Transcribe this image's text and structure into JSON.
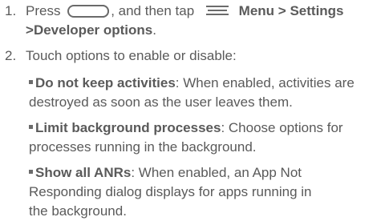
{
  "steps": [
    {
      "number": "1.",
      "press": "Press",
      "then_tap": ", and then tap",
      "menu": "Menu",
      "sep1": ">",
      "settings": "Settings",
      "sep2": ">",
      "developer_options": "Developer options",
      "end": ".",
      "icons": [
        "home-button-icon",
        "menu-icon"
      ]
    },
    {
      "number": "2.",
      "text": "Touch options to enable or disable:"
    }
  ],
  "options": [
    {
      "name": "Do not keep activities",
      "desc_line1": ": When enabled, activities are",
      "desc_line2": "destroyed as soon as the user leaves them."
    },
    {
      "name": "Limit background processes",
      "desc_line1": ": Choose options for",
      "desc_line2": "processes running in the background."
    },
    {
      "name": "Show all ANRs",
      "desc_line1": ": When enabled, an App Not",
      "desc_line2": "Responding dialog displays for apps running in",
      "desc_line3": "the background."
    }
  ]
}
